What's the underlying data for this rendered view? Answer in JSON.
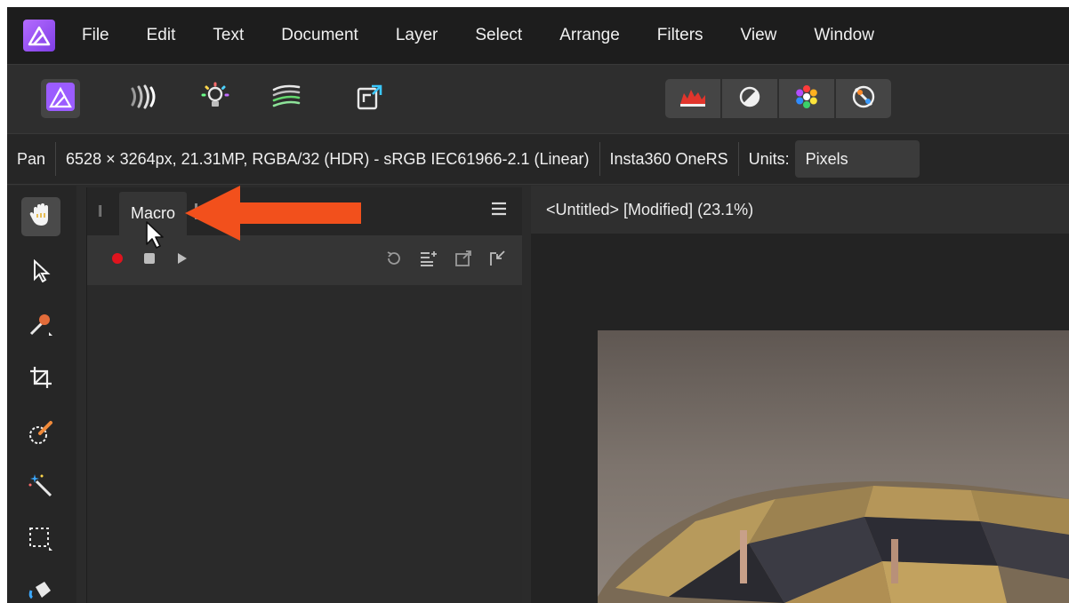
{
  "menu": {
    "items": [
      "File",
      "Edit",
      "Text",
      "Document",
      "Layer",
      "Select",
      "Arrange",
      "Filters",
      "View",
      "Window"
    ]
  },
  "toolbar": {
    "personas_left": [
      "photo-persona-icon",
      "liquify-persona-icon",
      "develop-persona-icon",
      "tone-mapping-persona-icon",
      "export-persona-icon"
    ],
    "studio_buttons": [
      "histogram-icon",
      "adjustment-icon",
      "color-wheel-icon",
      "brushes-icon"
    ]
  },
  "context": {
    "tool": "Pan",
    "doc_info": "6528 × 3264px, 21.31MP, RGBA/32 (HDR) - sRGB IEC61966-2.1 (Linear)",
    "camera": "Insta360 OneRS",
    "units_label": "Units:",
    "units_value": "Pixels"
  },
  "panel": {
    "tab_label": "Macro"
  },
  "document": {
    "tab_title": "<Untitled> [Modified] (23.1%)"
  },
  "colors": {
    "accent": "#9b5cff",
    "record": "#e0141e",
    "annotation_arrow": "#f2501c"
  }
}
